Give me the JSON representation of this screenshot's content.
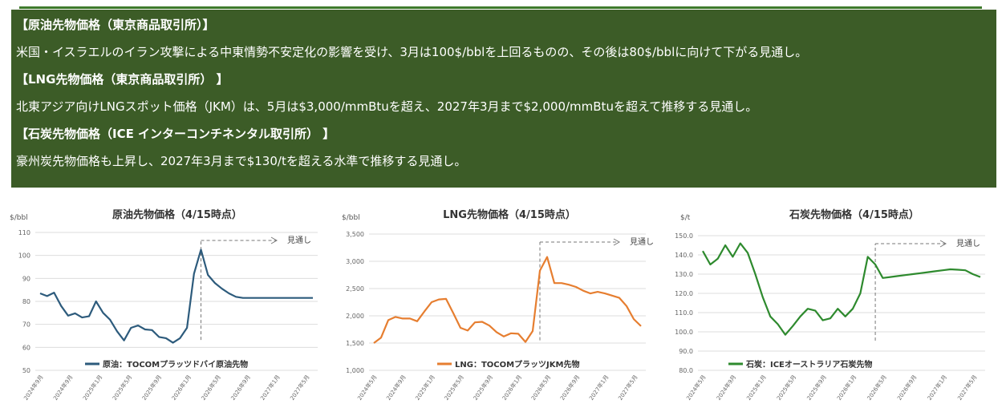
{
  "info_panel": {
    "lines": [
      {
        "heading": true,
        "text": "【原油先物価格（東京商品取引所）】"
      },
      {
        "heading": false,
        "text": "米国・イスラエルのイラン攻撃による中東情勢不安定化の影響を受け、3月は100$/bblを上回るものの、その後は80$/bblに向けて下がる見通し。"
      },
      {
        "heading": true,
        "text": "【LNG先物価格（東京商品取引所） 】"
      },
      {
        "heading": false,
        "text": "北東アジア向けLNGスポット価格（JKM）は、5月は$3,000/mmBtuを超え、2027年3月まで$2,000/mmBtuを超えて推移する見通し。"
      },
      {
        "heading": true,
        "text": "【石炭先物価格（ICE インターコンチネンタル取引所） 】"
      },
      {
        "heading": false,
        "text": "豪州炭先物価格も上昇し、2027年3月まで$130/tを超える水準で推移する見通し。"
      }
    ]
  },
  "chart_data": [
    {
      "type": "line",
      "title": "原油先物価格（4/15時点）",
      "unit": "$/bbl",
      "ylim": [
        50,
        110
      ],
      "yticks": [
        "110",
        "100",
        "90",
        "80",
        "70",
        "60",
        "50"
      ],
      "ytick_values": [
        110,
        100,
        90,
        80,
        70,
        60,
        50
      ],
      "xtick_labels": [
        "2024年9月",
        "2024年9月",
        "2025年1月",
        "2025年5月",
        "2025年9月",
        "2026年1月",
        "2026年5月",
        "2026年9月",
        "2027年1月",
        "2027年5月"
      ],
      "annotation": "見通し",
      "forecast_start_index": 24,
      "legend": "原油：TOCOMプラッツドバイ原油先物",
      "color": "#2d5b7c",
      "grid": true,
      "series": [
        {
          "name": "原油：TOCOMプラッツドバイ原油先物",
          "values": [
            83.5,
            82.3,
            83.8,
            78,
            73.8,
            74.8,
            73,
            73.5,
            80,
            75,
            72,
            67,
            63,
            68.5,
            69.5,
            67.8,
            67.5,
            64.5,
            64,
            62,
            64,
            68.5,
            92,
            102.5,
            91.5,
            88,
            85.5,
            83.5,
            82,
            81.5,
            81.5,
            81.5,
            81.5,
            81.5,
            81.5,
            81.5,
            81.5,
            81.5,
            81.5,
            81.5
          ]
        }
      ]
    },
    {
      "type": "line",
      "title": "LNG先物価格（4/15時点）",
      "unit": "$/bbl",
      "ylim": [
        1000,
        3500
      ],
      "yticks": [
        "3,500",
        "3,000",
        "2,500",
        "2,000",
        "1,500",
        "1,000"
      ],
      "ytick_values": [
        3500,
        3000,
        2500,
        2000,
        1500,
        1000
      ],
      "xtick_labels": [
        "2024年5月",
        "2024年9月",
        "2025年1月",
        "2025年5月",
        "2025年9月",
        "2026年1月",
        "2026年5月",
        "2026年9月",
        "2027年1月",
        "2027年5月"
      ],
      "annotation": "見通し",
      "forecast_start_index": 24,
      "legend": "LNG：TOCOMプラッツJKM先物",
      "color": "#e67e30",
      "grid": true,
      "series": [
        {
          "name": "LNG：TOCOMプラッツJKM先物",
          "values": [
            1500,
            1600,
            1920,
            1980,
            1950,
            1950,
            1900,
            2080,
            2250,
            2300,
            2310,
            2050,
            1780,
            1730,
            1880,
            1890,
            1820,
            1700,
            1620,
            1680,
            1670,
            1520,
            1720,
            2830,
            3080,
            2600,
            2600,
            2570,
            2530,
            2460,
            2410,
            2440,
            2410,
            2370,
            2330,
            2180,
            1940,
            1810
          ]
        }
      ]
    },
    {
      "type": "line",
      "title": "石炭先物価格（4/15時点）",
      "unit": "$/t",
      "ylim": [
        80,
        150
      ],
      "yticks": [
        "150.0",
        "140.0",
        "130.0",
        "120.0",
        "110.0",
        "100.0",
        "90.0",
        "80.0"
      ],
      "ytick_values": [
        150,
        140,
        130,
        120,
        110,
        100,
        90,
        80
      ],
      "xtick_labels": [
        "2024年5月",
        "2024年9月",
        "2025年1月",
        "2025年5月",
        "2025年9月",
        "2026年1月",
        "2026年5月",
        "2026年9月",
        "2027年1月",
        "2027年5月"
      ],
      "annotation": "見通し",
      "forecast_start_index": 24,
      "legend": "石炭：ICEオーストラリア石炭先物",
      "color": "#2e8a2e",
      "grid": true,
      "series": [
        {
          "name": "石炭：ICEオーストラリア石炭先物",
          "values": [
            142,
            135,
            138,
            145,
            139,
            146,
            141,
            130,
            118,
            108,
            104,
            98.5,
            103,
            108,
            112,
            111,
            106,
            107,
            112,
            108,
            112,
            120,
            139,
            135,
            128,
            128.5,
            129,
            129.5,
            130,
            130.5,
            131,
            131.5,
            132,
            132.5,
            132.3,
            132,
            130,
            128.5
          ]
        }
      ]
    }
  ]
}
